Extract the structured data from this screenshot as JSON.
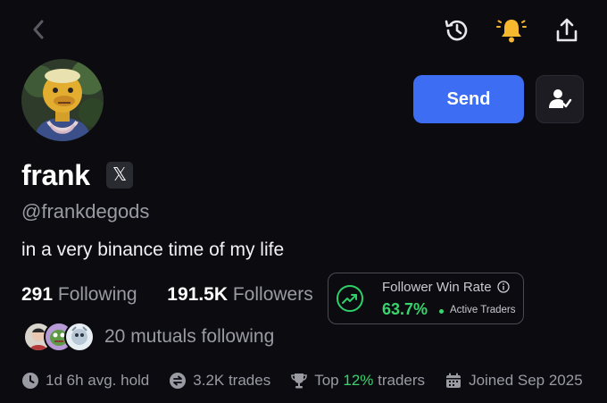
{
  "profile": {
    "name": "frank",
    "x_badge": "𝕏",
    "handle": "@frankdegods",
    "bio": "in a very binance time of my life"
  },
  "actions": {
    "send_label": "Send"
  },
  "stats": {
    "following_count": "291",
    "following_label": "Following",
    "followers_count": "191.5K",
    "followers_label": "Followers"
  },
  "win_rate": {
    "label": "Follower Win Rate",
    "value": "63.7%",
    "note": "Active Traders"
  },
  "mutuals": {
    "text": "20 mutuals following"
  },
  "footer": {
    "hold": "1d 6h avg. hold",
    "trades": "3.2K trades",
    "top_prefix": "Top",
    "top_percent": "12%",
    "top_suffix": "traders",
    "joined": "Joined Sep 2025"
  },
  "icons": {
    "back": "chevron-left-icon",
    "history": "history-icon",
    "notifications": "bell-icon",
    "share": "share-icon",
    "follow": "user-check-icon",
    "x": "x-logo-icon",
    "win_rate": "trend-up-icon",
    "info": "info-icon",
    "hold": "clock-icon",
    "trades": "swap-icon",
    "top": "trophy-icon",
    "joined": "calendar-icon"
  },
  "colors": {
    "background": "#0b0b10",
    "accent": "#3d6df2",
    "bell": "#f5b82e",
    "positive": "#39d46e",
    "muted": "#9a9aa3"
  }
}
